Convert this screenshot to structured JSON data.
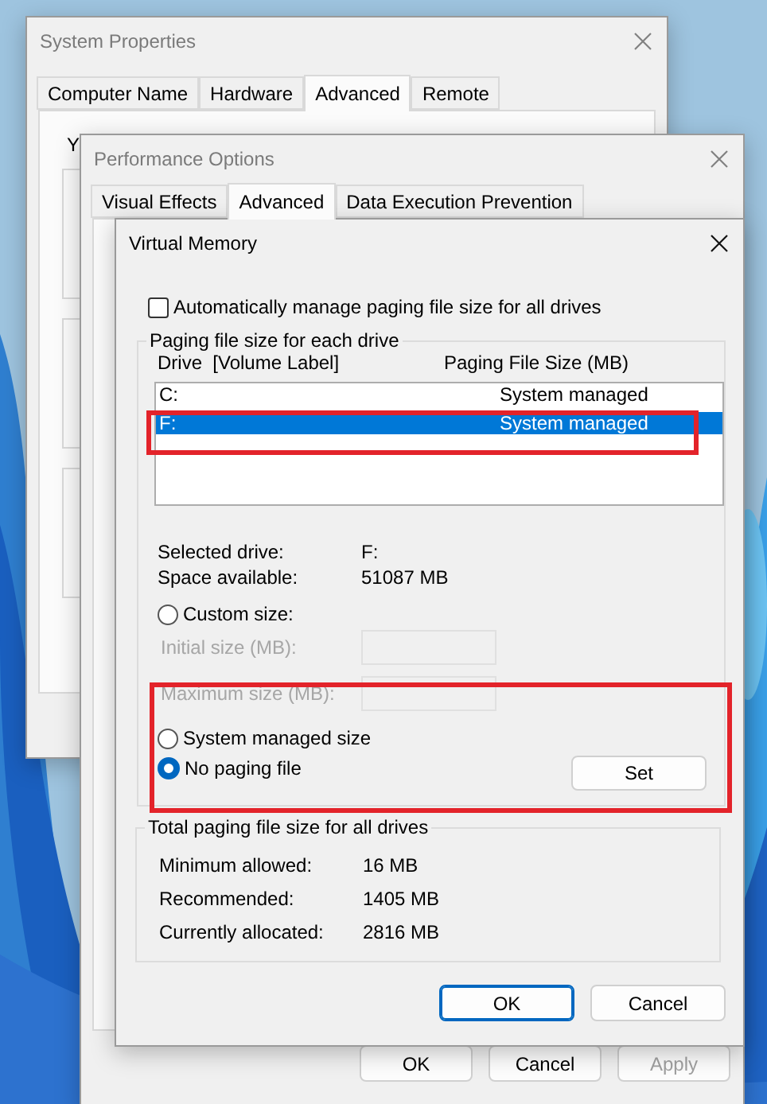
{
  "system_properties": {
    "title": "System Properties",
    "tabs": [
      {
        "label": "Computer Name",
        "selected": false
      },
      {
        "label": "Hardware",
        "selected": false
      },
      {
        "label": "Advanced",
        "selected": true
      },
      {
        "label": "Remote",
        "selected": false
      }
    ],
    "intro_fragment": "Y"
  },
  "performance_options": {
    "title": "Performance Options",
    "tabs": [
      {
        "label": "Visual Effects",
        "selected": false
      },
      {
        "label": "Advanced",
        "selected": true
      },
      {
        "label": "Data Execution Prevention",
        "selected": false
      }
    ],
    "buttons": [
      {
        "label": "OK",
        "disabled": false
      },
      {
        "label": "Cancel",
        "disabled": false
      },
      {
        "label": "Apply",
        "disabled": true
      }
    ]
  },
  "virtual_memory": {
    "title": "Virtual Memory",
    "auto_manage": {
      "label": "Automatically manage paging file size for all drives",
      "checked": false
    },
    "paging_group": {
      "title": "Paging file size for each drive",
      "columns": [
        "Drive  [Volume Label]",
        "Paging File Size (MB)"
      ],
      "drives": [
        {
          "drive": "C:",
          "size": "System managed",
          "selected": false
        },
        {
          "drive": "F:",
          "size": "System managed",
          "selected": true
        }
      ],
      "info": [
        {
          "label": "Selected drive:",
          "value": "F:"
        },
        {
          "label": "Space available:",
          "value": "51087 MB"
        }
      ],
      "options": [
        {
          "label": "Custom size:",
          "selected": false
        },
        {
          "label": "System managed size",
          "selected": false
        },
        {
          "label": "No paging file",
          "selected": true
        }
      ],
      "fields": [
        {
          "label": "Initial size (MB):",
          "disabled": true
        },
        {
          "label": "Maximum size (MB):",
          "disabled": true
        }
      ],
      "set_button": "Set"
    },
    "totals_group": {
      "title": "Total paging file size for all drives",
      "rows": [
        {
          "label": "Minimum allowed:",
          "value": "16 MB"
        },
        {
          "label": "Recommended:",
          "value": "1405 MB"
        },
        {
          "label": "Currently allocated:",
          "value": "2816 MB"
        }
      ]
    },
    "buttons": [
      {
        "label": "OK",
        "default": true
      },
      {
        "label": "Cancel",
        "default": false
      }
    ]
  },
  "annotations": [
    {
      "kind": "box",
      "color": "#e3232a"
    },
    {
      "kind": "box",
      "color": "#e3232a"
    }
  ]
}
